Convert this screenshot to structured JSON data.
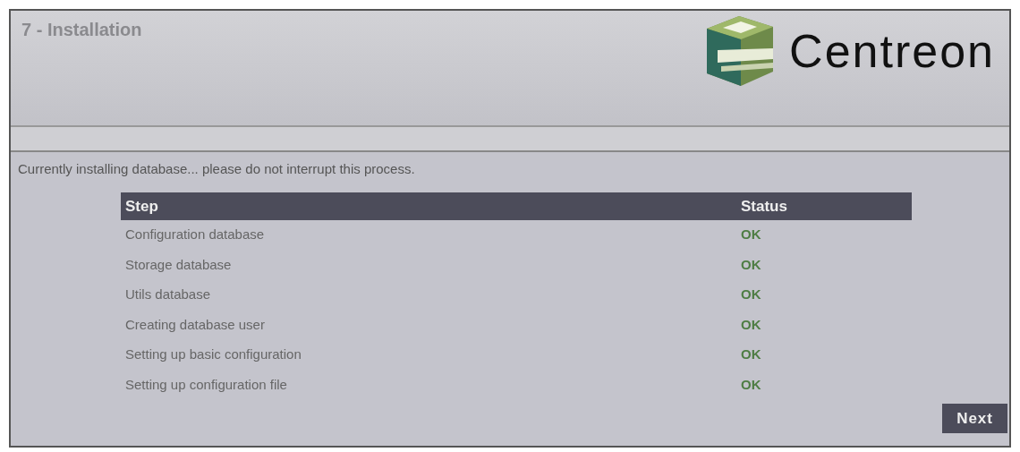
{
  "header": {
    "title": "7 - Installation",
    "logo_text": "Centreon"
  },
  "message": "Currently installing database... please do not interrupt this process.",
  "table": {
    "columns": [
      "Step",
      "Status"
    ],
    "rows": [
      {
        "step": "Configuration database",
        "status": "OK"
      },
      {
        "step": "Storage database",
        "status": "OK"
      },
      {
        "step": "Utils database",
        "status": "OK"
      },
      {
        "step": "Creating database user",
        "status": "OK"
      },
      {
        "step": "Setting up basic configuration",
        "status": "OK"
      },
      {
        "step": "Setting up configuration file",
        "status": "OK"
      }
    ]
  },
  "buttons": [
    {
      "label": "Next"
    }
  ]
}
